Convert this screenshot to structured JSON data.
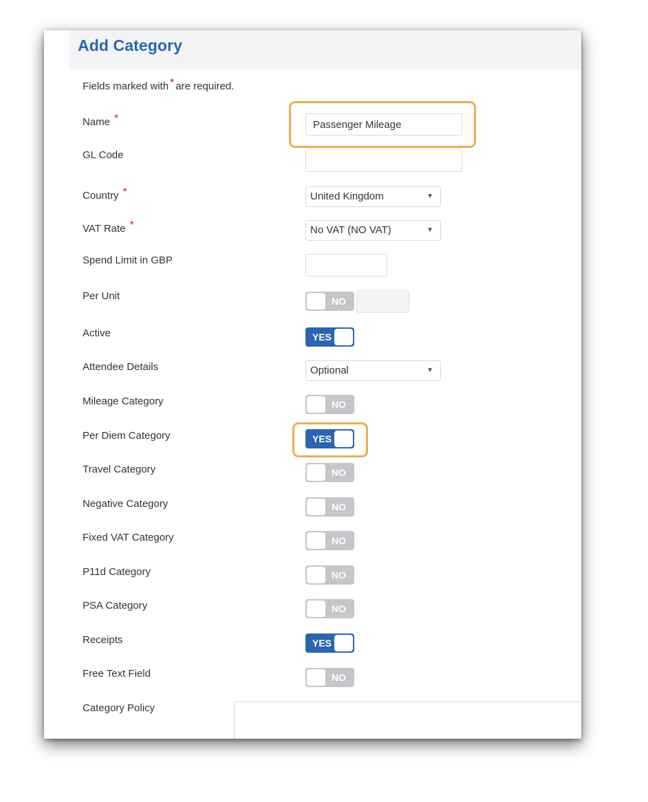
{
  "header": {
    "title": "Add Category"
  },
  "note": {
    "prefix": "Fields marked with",
    "asterisk": "*",
    "suffix": "are required."
  },
  "fields": {
    "name": {
      "label": "Name",
      "value": "Passenger Mileage"
    },
    "gl_code": {
      "label": "GL Code",
      "value": ""
    },
    "country": {
      "label": "Country",
      "value": "United Kingdom"
    },
    "vat_rate": {
      "label": "VAT Rate",
      "value": "No VAT (NO VAT)"
    },
    "spend_limit": {
      "label": "Spend Limit in GBP",
      "value": ""
    },
    "per_unit": {
      "label": "Per Unit",
      "state": "NO"
    },
    "active": {
      "label": "Active",
      "state": "YES"
    },
    "attendee_details": {
      "label": "Attendee Details",
      "value": "Optional"
    },
    "mileage_category": {
      "label": "Mileage Category",
      "state": "NO"
    },
    "per_diem_category": {
      "label": "Per Diem Category",
      "state": "YES"
    },
    "travel_category": {
      "label": "Travel Category",
      "state": "NO"
    },
    "negative_category": {
      "label": "Negative Category",
      "state": "NO"
    },
    "fixed_vat_category": {
      "label": "Fixed VAT Category",
      "state": "NO"
    },
    "p11d_category": {
      "label": "P11d Category",
      "state": "NO"
    },
    "psa_category": {
      "label": "PSA Category",
      "state": "NO"
    },
    "receipts": {
      "label": "Receipts",
      "state": "YES"
    },
    "free_text_field": {
      "label": "Free Text Field",
      "state": "NO"
    },
    "category_policy": {
      "label": "Category Policy",
      "value": ""
    }
  },
  "required_marker": "*",
  "colors": {
    "brand_blue": "#2c65ae",
    "toggle_off": "#c4c6c9",
    "highlight": "#e9b052",
    "required": "#cc2222"
  },
  "icons": {
    "select_caret": "caret-down-icon"
  }
}
